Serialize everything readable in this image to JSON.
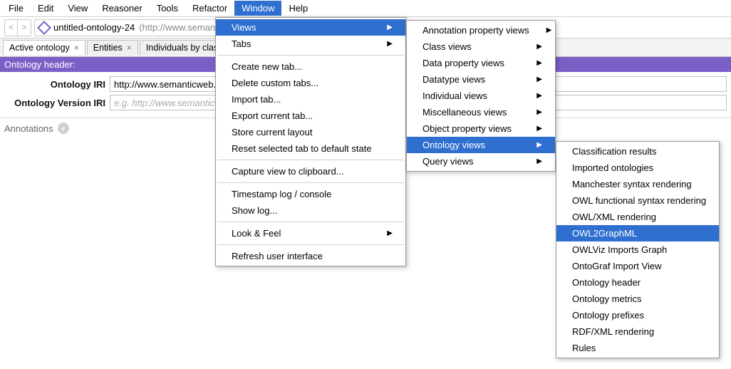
{
  "menubar": {
    "items": [
      "File",
      "Edit",
      "View",
      "Reasoner",
      "Tools",
      "Refactor",
      "Window",
      "Help"
    ],
    "selected": "Window"
  },
  "toolbar": {
    "back_glyph": "<",
    "fwd_glyph": ">",
    "title": "untitled-ontology-24",
    "url_hint": "(http://www.semant"
  },
  "tabs": [
    {
      "label": "Active ontology",
      "closable": true,
      "active": true
    },
    {
      "label": "Entities",
      "closable": true,
      "active": false
    },
    {
      "label": "Individuals by class",
      "closable": false,
      "active": false
    }
  ],
  "section_header": "Ontology header:",
  "form": {
    "iri_label": "Ontology IRI",
    "iri_value": "http://www.semanticweb.or",
    "ver_label": "Ontology Version IRI",
    "ver_placeholder": "e.g. http://www.semanticwe"
  },
  "annotations_label": "Annotations",
  "window_menu": {
    "items": [
      {
        "label": "Views",
        "submenu": true,
        "highlight": true
      },
      {
        "label": "Tabs",
        "submenu": true
      },
      {
        "sep": true
      },
      {
        "label": "Create new tab..."
      },
      {
        "label": "Delete custom tabs..."
      },
      {
        "label": "Import tab..."
      },
      {
        "label": "Export current tab..."
      },
      {
        "label": "Store current layout"
      },
      {
        "label": "Reset selected tab to default state"
      },
      {
        "sep": true
      },
      {
        "label": "Capture view to clipboard..."
      },
      {
        "sep": true
      },
      {
        "label": "Timestamp log / console"
      },
      {
        "label": "Show log..."
      },
      {
        "sep": true
      },
      {
        "label": "Look & Feel",
        "submenu": true
      },
      {
        "sep": true
      },
      {
        "label": "Refresh user interface"
      }
    ]
  },
  "views_menu": {
    "items": [
      {
        "label": "Annotation property views",
        "submenu": true
      },
      {
        "label": "Class views",
        "submenu": true
      },
      {
        "label": "Data property views",
        "submenu": true
      },
      {
        "label": "Datatype views",
        "submenu": true
      },
      {
        "label": "Individual views",
        "submenu": true
      },
      {
        "label": "Miscellaneous views",
        "submenu": true
      },
      {
        "label": "Object property views",
        "submenu": true
      },
      {
        "label": "Ontology views",
        "submenu": true,
        "highlight": true
      },
      {
        "label": "Query views",
        "submenu": true
      }
    ]
  },
  "ontology_views_menu": {
    "items": [
      {
        "label": "Classification results"
      },
      {
        "label": "Imported ontologies"
      },
      {
        "label": "Manchester syntax rendering"
      },
      {
        "label": "OWL functional syntax rendering"
      },
      {
        "label": "OWL/XML rendering"
      },
      {
        "label": "OWL2GraphML",
        "highlight": true
      },
      {
        "label": "OWLViz Imports Graph"
      },
      {
        "label": "OntoGraf Import View"
      },
      {
        "label": "Ontology header"
      },
      {
        "label": "Ontology metrics"
      },
      {
        "label": "Ontology prefixes"
      },
      {
        "label": "RDF/XML rendering"
      },
      {
        "label": "Rules"
      }
    ]
  }
}
